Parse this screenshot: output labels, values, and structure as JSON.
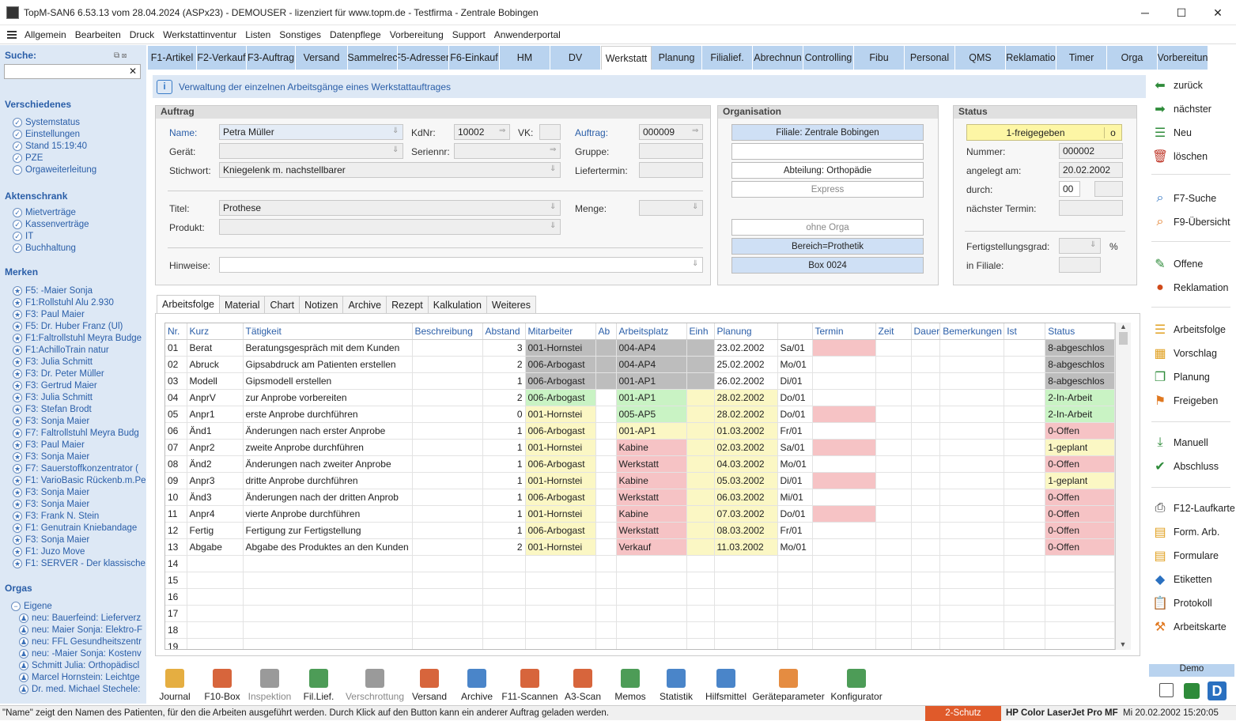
{
  "window": {
    "title": "TopM-SAN6 6.53.13 vom 28.04.2024 (ASPx23) - DEMOUSER - lizenziert für www.topm.de - Testfirma - Zentrale Bobingen",
    "min": "─",
    "max": "☐",
    "close": "✕"
  },
  "menu": [
    "Allgemein",
    "Bearbeiten",
    "Druck",
    "Werkstattinventur",
    "Listen",
    "Sonstiges",
    "Datenpflege",
    "Vorbereitung",
    "Support",
    "Anwenderportal"
  ],
  "sidebar": {
    "search_label": "Suche:",
    "search_clear": "✕",
    "search_icons": "⧉ ⊠",
    "sections": [
      {
        "title": "Verschiedenes",
        "items": [
          "Systemstatus",
          "Einstellungen",
          "Stand 15:19:40",
          "PZE",
          "Orgaweiterleitung"
        ]
      },
      {
        "title": "Aktenschrank",
        "items": [
          "Mietverträge",
          "Kassenverträge",
          "IT",
          "Buchhaltung"
        ]
      },
      {
        "title": "Merken",
        "items": [
          "F5: -Maier Sonja",
          "F1:Rollstuhl Alu 2.930",
          "F3: Paul Maier",
          "F5: Dr. Huber Franz (Ul)",
          "F1:Faltrollstuhl Meyra Budge",
          "F1:AchilloTrain natur",
          "F3: Julia Schmitt",
          "F3: Dr. Peter Müller",
          "F3: Gertrud Maier",
          "F3: Julia Schmitt",
          "F3: Stefan Brodt",
          "F3: Sonja Maier",
          "F7: Faltrollstuhl Meyra Budg",
          "F3: Paul Maier",
          "F3: Sonja Maier",
          "F7: Sauerstoffkonzentrator (",
          "F1: VarioBasic Rückenb.m.Pe",
          "F3: Sonja Maier",
          "F3: Sonja Maier",
          "F3: Frank N. Stein",
          "F1: Genutrain Kniebandage",
          "F3: Sonja Maier",
          "F1: Juzo Move",
          "F1: SERVER - Der klassische ."
        ]
      },
      {
        "title": "Orgas",
        "items": [
          "Eigene",
          "neu: Bauerfeind: Lieferverz",
          "neu: Maier Sonja: Elektro-F",
          "neu: FFL Gesundheitszentr",
          "neu: -Maier Sonja: Kostenv",
          "Schmitt Julia: Orthopädiscl",
          "Marcel Hornstein: Leichtge",
          "Dr. med. Michael Stechele:"
        ]
      }
    ]
  },
  "tabs": [
    {
      "label": "F1-Artikel",
      "w": 62
    },
    {
      "label": "F2-Verkauf",
      "w": 63
    },
    {
      "label": "F3-Auftrag",
      "w": 62
    },
    {
      "label": "Versand",
      "w": 66
    },
    {
      "label": "Sammelrec",
      "w": 63
    },
    {
      "label": "F5-Adressen",
      "w": 65
    },
    {
      "label": "F6-Einkauf",
      "w": 64
    },
    {
      "label": "HM",
      "w": 64
    },
    {
      "label": "DV",
      "w": 64
    },
    {
      "label": "Werkstatt",
      "w": 64,
      "active": true
    },
    {
      "label": "Planung",
      "w": 64
    },
    {
      "label": "Filialief.",
      "w": 64
    },
    {
      "label": "Abrechnun",
      "w": 64
    },
    {
      "label": "Controlling",
      "w": 64
    },
    {
      "label": "Fibu",
      "w": 64
    },
    {
      "label": "Personal",
      "w": 64
    },
    {
      "label": "QMS",
      "w": 64
    },
    {
      "label": "Reklamatio",
      "w": 64
    },
    {
      "label": "Timer",
      "w": 64
    },
    {
      "label": "Orga",
      "w": 64
    },
    {
      "label": "Vorbereitun",
      "w": 64
    }
  ],
  "info_text": "Verwaltung der einzelnen Arbeitsgänge eines Werkstattauftrages",
  "auftrag": {
    "title": "Auftrag",
    "name_label": "Name:",
    "name": "Petra Müller",
    "kdnr_label": "KdNr:",
    "kdnr": "10002",
    "vk_label": "VK:",
    "auftrag_label": "Auftrag:",
    "auftrag": "000009",
    "geraet_label": "Gerät:",
    "seriennr_label": "Seriennr:",
    "gruppe_label": "Gruppe:",
    "stichwort_label": "Stichwort:",
    "stichwort": "Kniegelenk m. nachstellbarer",
    "liefertermin_label": "Liefertermin:",
    "titel_label": "Titel:",
    "titel": "Prothese",
    "menge_label": "Menge:",
    "produkt_label": "Produkt:",
    "hinweise_label": "Hinweise:"
  },
  "organisation": {
    "title": "Organisation",
    "filiale": "Filiale: Zentrale Bobingen",
    "abteilung": "Abteilung: Orthopädie",
    "express": "Express",
    "ohne_orga": "ohne Orga",
    "bereich": "Bereich=Prothetik",
    "box": "Box 0024"
  },
  "status": {
    "title": "Status",
    "state": "1-freigegeben",
    "state_btn": "o",
    "nummer_label": "Nummer:",
    "nummer": "000002",
    "angelegt_label": "angelegt am:",
    "angelegt": "20.02.2002",
    "durch_label": "durch:",
    "durch": "00",
    "termin_label": "nächster Termin:",
    "fertig_label": "Fertigstellungsgrad:",
    "fertig_unit": "%",
    "filiale_label": "in Filiale:"
  },
  "actions": [
    {
      "label": "zurück",
      "icon": "arrow-left",
      "color": "#2e8b3a",
      "glyph": "⬅"
    },
    {
      "label": "nächster",
      "icon": "arrow-right",
      "color": "#2e8b3a",
      "glyph": "➡"
    },
    {
      "label": "Neu",
      "icon": "new-list",
      "color": "#2e8b3a",
      "glyph": "☰"
    },
    {
      "label": "löschen",
      "icon": "trash",
      "color": "#c0392b",
      "glyph": "🗑"
    },
    {
      "label": "F7-Suche",
      "icon": "search-window",
      "color": "#2a70c0",
      "glyph": "⌕"
    },
    {
      "label": "F9-Übersicht",
      "icon": "overview",
      "color": "#e07820",
      "glyph": "⌕"
    },
    {
      "label": "Offene",
      "icon": "edit",
      "color": "#2e8b3a",
      "glyph": "✎"
    },
    {
      "label": "Reklamation",
      "icon": "reklamation",
      "color": "#d04a1a",
      "glyph": "●"
    },
    {
      "label": "Arbeitsfolge",
      "icon": "list-doc",
      "color": "#e0a020",
      "glyph": "☰"
    },
    {
      "label": "Vorschlag",
      "icon": "calendar",
      "color": "#e0a020",
      "glyph": "▦"
    },
    {
      "label": "Planung",
      "icon": "copy",
      "color": "#2e8b3a",
      "glyph": "❐"
    },
    {
      "label": "Freigeben",
      "icon": "release",
      "color": "#e07820",
      "glyph": "⚑"
    },
    {
      "label": "Manuell",
      "icon": "download",
      "color": "#2e8b3a",
      "glyph": "⤓"
    },
    {
      "label": "Abschluss",
      "icon": "check-circle",
      "color": "#2e8b3a",
      "glyph": "✔"
    },
    {
      "label": "F12-Laufkarte",
      "icon": "printer",
      "color": "#333",
      "glyph": "⎙"
    },
    {
      "label": "Form. Arb.",
      "icon": "form",
      "color": "#e0a020",
      "glyph": "▤"
    },
    {
      "label": "Formulare",
      "icon": "forms",
      "color": "#e0a020",
      "glyph": "▤"
    },
    {
      "label": "Etiketten",
      "icon": "label",
      "color": "#2a70c0",
      "glyph": "◆"
    },
    {
      "label": "Protokoll",
      "icon": "clipboard",
      "color": "#2a70c0",
      "glyph": "📋"
    },
    {
      "label": "Arbeitskarte",
      "icon": "workcard",
      "color": "#e07820",
      "glyph": "⚒"
    }
  ],
  "subtabs": [
    "Arbeitsfolge",
    "Material",
    "Chart",
    "Notizen",
    "Archive",
    "Rezept",
    "Kalkulation",
    "Weiteres"
  ],
  "grid": {
    "columns": [
      "Nr.",
      "Kurz",
      "Tätigkeit",
      "Beschreibung",
      "Abstand",
      "Mitarbeiter",
      "Ab",
      "Arbeitsplatz",
      "Einh",
      "Planung",
      "",
      "Termin",
      "Zeit",
      "Dauer",
      "Bemerkungen",
      "Ist",
      "Status"
    ],
    "rows": [
      [
        "01",
        "Berat",
        "Beratungsgespräch mit dem Kunden",
        "",
        "3",
        "001-Hornstei",
        "",
        "004-AP4",
        "",
        "23.02.2002",
        "Sa/01",
        "",
        "",
        "",
        "",
        "",
        "8-abgeschlos"
      ],
      [
        "02",
        "Abruck",
        "Gipsabdruck am Patienten erstellen",
        "",
        "2",
        "006-Arbogast",
        "",
        "004-AP4",
        "",
        "25.02.2002",
        "Mo/01",
        "",
        "",
        "",
        "",
        "",
        "8-abgeschlos"
      ],
      [
        "03",
        "Modell",
        "Gipsmodell erstellen",
        "",
        "1",
        "006-Arbogast",
        "",
        "001-AP1",
        "",
        "26.02.2002",
        "Di/01",
        "",
        "",
        "",
        "",
        "",
        "8-abgeschlos"
      ],
      [
        "04",
        "AnprV",
        "zur Anprobe vorbereiten",
        "",
        "2",
        "006-Arbogast",
        "",
        "001-AP1",
        "",
        "28.02.2002",
        "Do/01",
        "",
        "",
        "",
        "",
        "",
        "2-In-Arbeit"
      ],
      [
        "05",
        "Anpr1",
        "erste Anprobe durchführen",
        "",
        "0",
        "001-Hornstei",
        "",
        "005-AP5",
        "",
        "28.02.2002",
        "Do/01",
        "",
        "",
        "",
        "",
        "",
        "2-In-Arbeit"
      ],
      [
        "06",
        "Änd1",
        "Änderungen nach erster Anprobe",
        "",
        "1",
        "006-Arbogast",
        "",
        "001-AP1",
        "",
        "01.03.2002",
        "Fr/01",
        "",
        "",
        "",
        "",
        "",
        "0-Offen"
      ],
      [
        "07",
        "Anpr2",
        "zweite Anprobe durchführen",
        "",
        "1",
        "001-Hornstei",
        "",
        "Kabine",
        "",
        "02.03.2002",
        "Sa/01",
        "",
        "",
        "",
        "",
        "",
        "1-geplant"
      ],
      [
        "08",
        "Änd2",
        "Änderungen nach zweiter Anprobe",
        "",
        "1",
        "006-Arbogast",
        "",
        "Werkstatt",
        "",
        "04.03.2002",
        "Mo/01",
        "",
        "",
        "",
        "",
        "",
        "0-Offen"
      ],
      [
        "09",
        "Anpr3",
        "dritte Anprobe durchführen",
        "",
        "1",
        "001-Hornstei",
        "",
        "Kabine",
        "",
        "05.03.2002",
        "Di/01",
        "",
        "",
        "",
        "",
        "",
        "1-geplant"
      ],
      [
        "10",
        "Änd3",
        "Änderungen nach der dritten Anprob",
        "",
        "1",
        "006-Arbogast",
        "",
        "Werkstatt",
        "",
        "06.03.2002",
        "Mi/01",
        "",
        "",
        "",
        "",
        "",
        "0-Offen"
      ],
      [
        "11",
        "Anpr4",
        "vierte Anprobe durchführen",
        "",
        "1",
        "001-Hornstei",
        "",
        "Kabine",
        "",
        "07.03.2002",
        "Do/01",
        "",
        "",
        "",
        "",
        "",
        "0-Offen"
      ],
      [
        "12",
        "Fertig",
        "Fertigung zur Fertigstellung",
        "",
        "1",
        "006-Arbogast",
        "",
        "Werkstatt",
        "",
        "08.03.2002",
        "Fr/01",
        "",
        "",
        "",
        "",
        "",
        "0-Offen"
      ],
      [
        "13",
        "Abgabe",
        "Abgabe des Produktes an den Kunden",
        "",
        "2",
        "001-Hornstei",
        "",
        "Verkauf",
        "",
        "11.03.2002",
        "Mo/01",
        "",
        "",
        "",
        "",
        "",
        "0-Offen"
      ],
      [
        "14",
        "",
        "",
        "",
        "",
        "",
        "",
        "",
        "",
        "",
        "",
        "",
        "",
        "",
        "",
        "",
        ""
      ],
      [
        "15",
        "",
        "",
        "",
        "",
        "",
        "",
        "",
        "",
        "",
        "",
        "",
        "",
        "",
        "",
        "",
        ""
      ],
      [
        "16",
        "",
        "",
        "",
        "",
        "",
        "",
        "",
        "",
        "",
        "",
        "",
        "",
        "",
        "",
        "",
        ""
      ],
      [
        "17",
        "",
        "",
        "",
        "",
        "",
        "",
        "",
        "",
        "",
        "",
        "",
        "",
        "",
        "",
        "",
        ""
      ],
      [
        "18",
        "",
        "",
        "",
        "",
        "",
        "",
        "",
        "",
        "",
        "",
        "",
        "",
        "",
        "",
        "",
        ""
      ],
      [
        "19",
        "",
        "",
        "",
        "",
        "",
        "",
        "",
        "",
        "",
        "",
        "",
        "",
        "",
        "",
        "",
        ""
      ]
    ]
  },
  "toolbar": [
    {
      "label": "Journal",
      "color": "#e0a020"
    },
    {
      "label": "F10-Box",
      "color": "#d04a1a"
    },
    {
      "label": "Inspektion",
      "color": "#888",
      "dim": true
    },
    {
      "label": "Fil.Lief.",
      "color": "#2e8b3a"
    },
    {
      "label": "Verschrottung",
      "color": "#888",
      "dim": true
    },
    {
      "label": "Versand",
      "color": "#d04a1a"
    },
    {
      "label": "Archive",
      "color": "#2a70c0"
    },
    {
      "label": "F11-Scannen",
      "color": "#d04a1a"
    },
    {
      "label": "A3-Scan",
      "color": "#d04a1a"
    },
    {
      "label": "Memos",
      "color": "#2e8b3a"
    },
    {
      "label": "Statistik",
      "color": "#2a70c0"
    },
    {
      "label": "Hilfsmittel",
      "color": "#2a70c0"
    },
    {
      "label": "Geräteparameter",
      "color": "#e07820"
    },
    {
      "label": "Konfigurator",
      "color": "#2e8b3a"
    }
  ],
  "demo": "Demo",
  "statusbar": {
    "hint": "\"Name\" zeigt den Namen des Patienten, für den die Arbeiten ausgeführt werden. Durch Klick auf den Button kann ein anderer Auftrag geladen werden.",
    "schutz": "2-Schutz",
    "printer": "HP Color LaserJet Pro MFP M",
    "datetime": "Mi 20.02.2002 15:20:05"
  }
}
